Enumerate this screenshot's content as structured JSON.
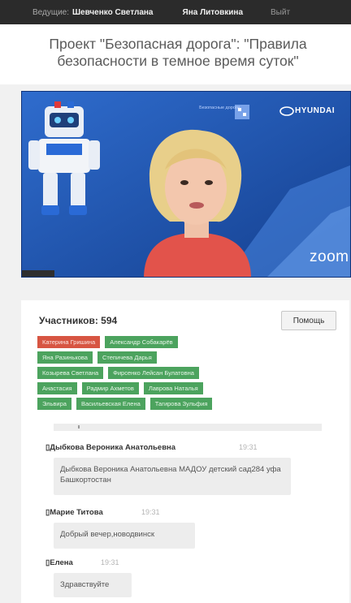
{
  "topbar": {
    "host_label": "Ведущие:",
    "host_name": "Шевченко Светлана",
    "user_name": "Яна Литовкина",
    "exit_label": "Выйт"
  },
  "page": {
    "title": "Проект \"Безопасная дорога\": \"Правила безопасности в темное время суток\""
  },
  "video": {
    "sponsor_text": "Безопасные дороги",
    "brand": "HYUNDAI",
    "watermark": "zoom",
    "colors": {
      "background": "#1d4fa0",
      "accent": "#2a66c9"
    }
  },
  "participants": {
    "count_label": "Участников: 594",
    "help_label": "Помощь",
    "tags": [
      [
        {
          "name": "Катерина Гришина",
          "color": "#d75542"
        },
        {
          "name": "Александр Собакарёв",
          "color": "#4ca35e"
        }
      ],
      [
        {
          "name": "Яна Разинькова",
          "color": "#4ca35e"
        },
        {
          "name": "Степичева Дарья",
          "color": "#4ca35e"
        }
      ],
      [
        {
          "name": "Козырева Светлана",
          "color": "#4ca35e"
        },
        {
          "name": "Фирсенко Лейсан Булатовна",
          "color": "#4ca35e"
        }
      ],
      [
        {
          "name": "Анастасия",
          "color": "#4ca35e"
        },
        {
          "name": "Радмир Ахметов",
          "color": "#4ca35e"
        },
        {
          "name": "Лаврова Наталья",
          "color": "#4ca35e"
        }
      ],
      [
        {
          "name": "Эльвира",
          "color": "#4ca35e"
        },
        {
          "name": "Васильевская Елена",
          "color": "#4ca35e"
        },
        {
          "name": "Тагирова Зульфия",
          "color": "#4ca35e"
        }
      ]
    ]
  },
  "chat": {
    "messages": [
      {
        "author": "Дыбкова Вероника Анатольевна",
        "time": "19:31",
        "text": "Дыбкова Вероника Анатольевна МАДОУ детский сад284 уфа Башкортостан"
      },
      {
        "author": "Марие Титова",
        "time": "19:31",
        "text": "Добрый вечер,новодвинск"
      },
      {
        "author": "Елена",
        "time": "19:31",
        "text": "Здравствуйте"
      }
    ]
  }
}
